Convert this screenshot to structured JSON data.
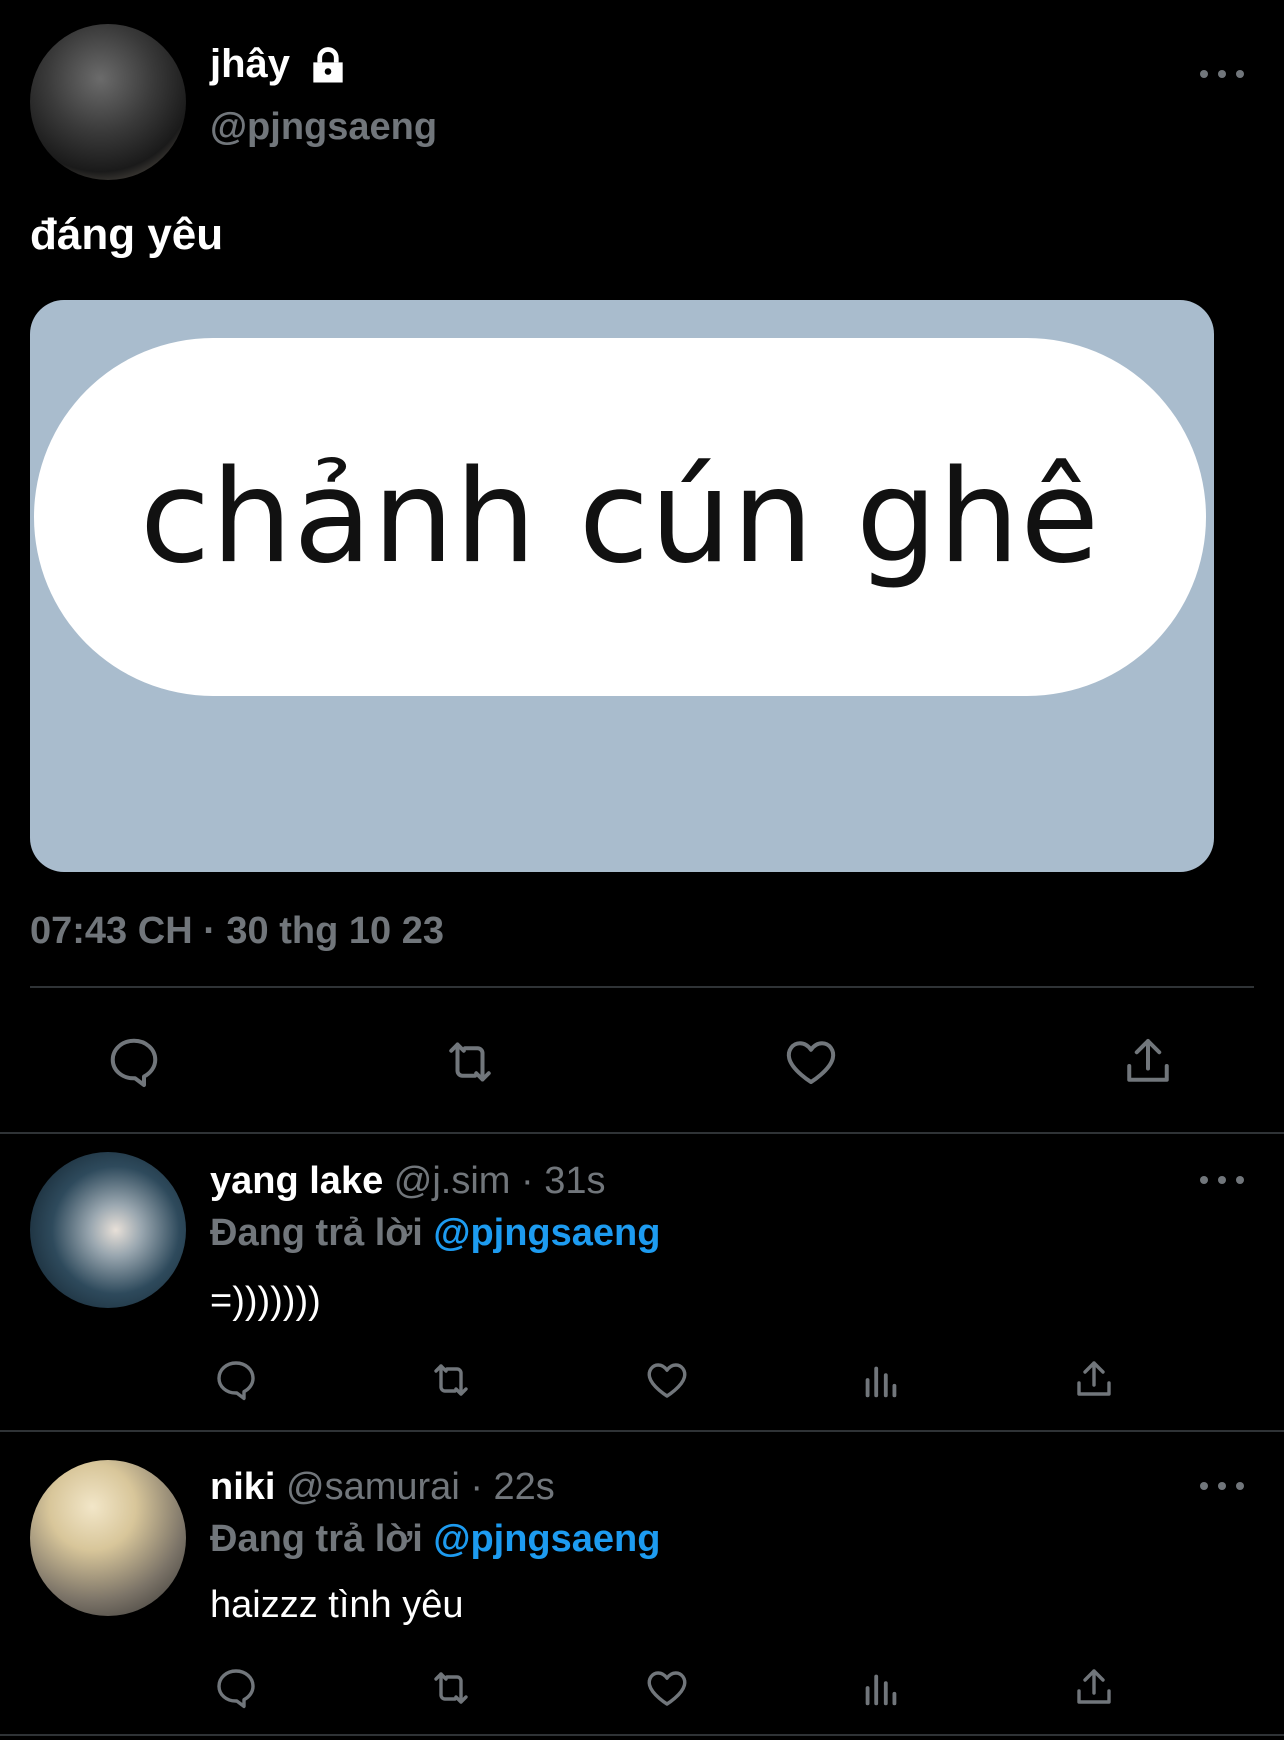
{
  "main_tweet": {
    "author_name": "jhây",
    "handle": "@pjngsaeng",
    "text": "đáng yêu",
    "image_text": "chảnh cún ghê",
    "timestamp": "07:43 CH · 30 thg 10 23",
    "icons": [
      "reply-icon",
      "retweet-icon",
      "like-icon",
      "share-icon"
    ]
  },
  "replies": [
    {
      "name": "yang lake",
      "handle": "@j.sim",
      "time": "· 31s",
      "replying_prefix": "Đang trả lời",
      "replying_to": "@pjngsaeng",
      "text": "=)))))))",
      "icons": [
        "reply-icon",
        "retweet-icon",
        "like-icon",
        "views-icon",
        "share-icon"
      ]
    },
    {
      "name": "niki",
      "handle": "@samurai",
      "time": "· 22s",
      "replying_prefix": "Đang trả lời",
      "replying_to": "@pjngsaeng",
      "text": "haizzz tình yêu",
      "icons": [
        "reply-icon",
        "retweet-icon",
        "like-icon",
        "views-icon",
        "share-icon"
      ]
    }
  ],
  "colors": {
    "background": "#000000",
    "muted": "#71767b",
    "link": "#1d9bf0",
    "media_bg": "#a9bccd"
  }
}
